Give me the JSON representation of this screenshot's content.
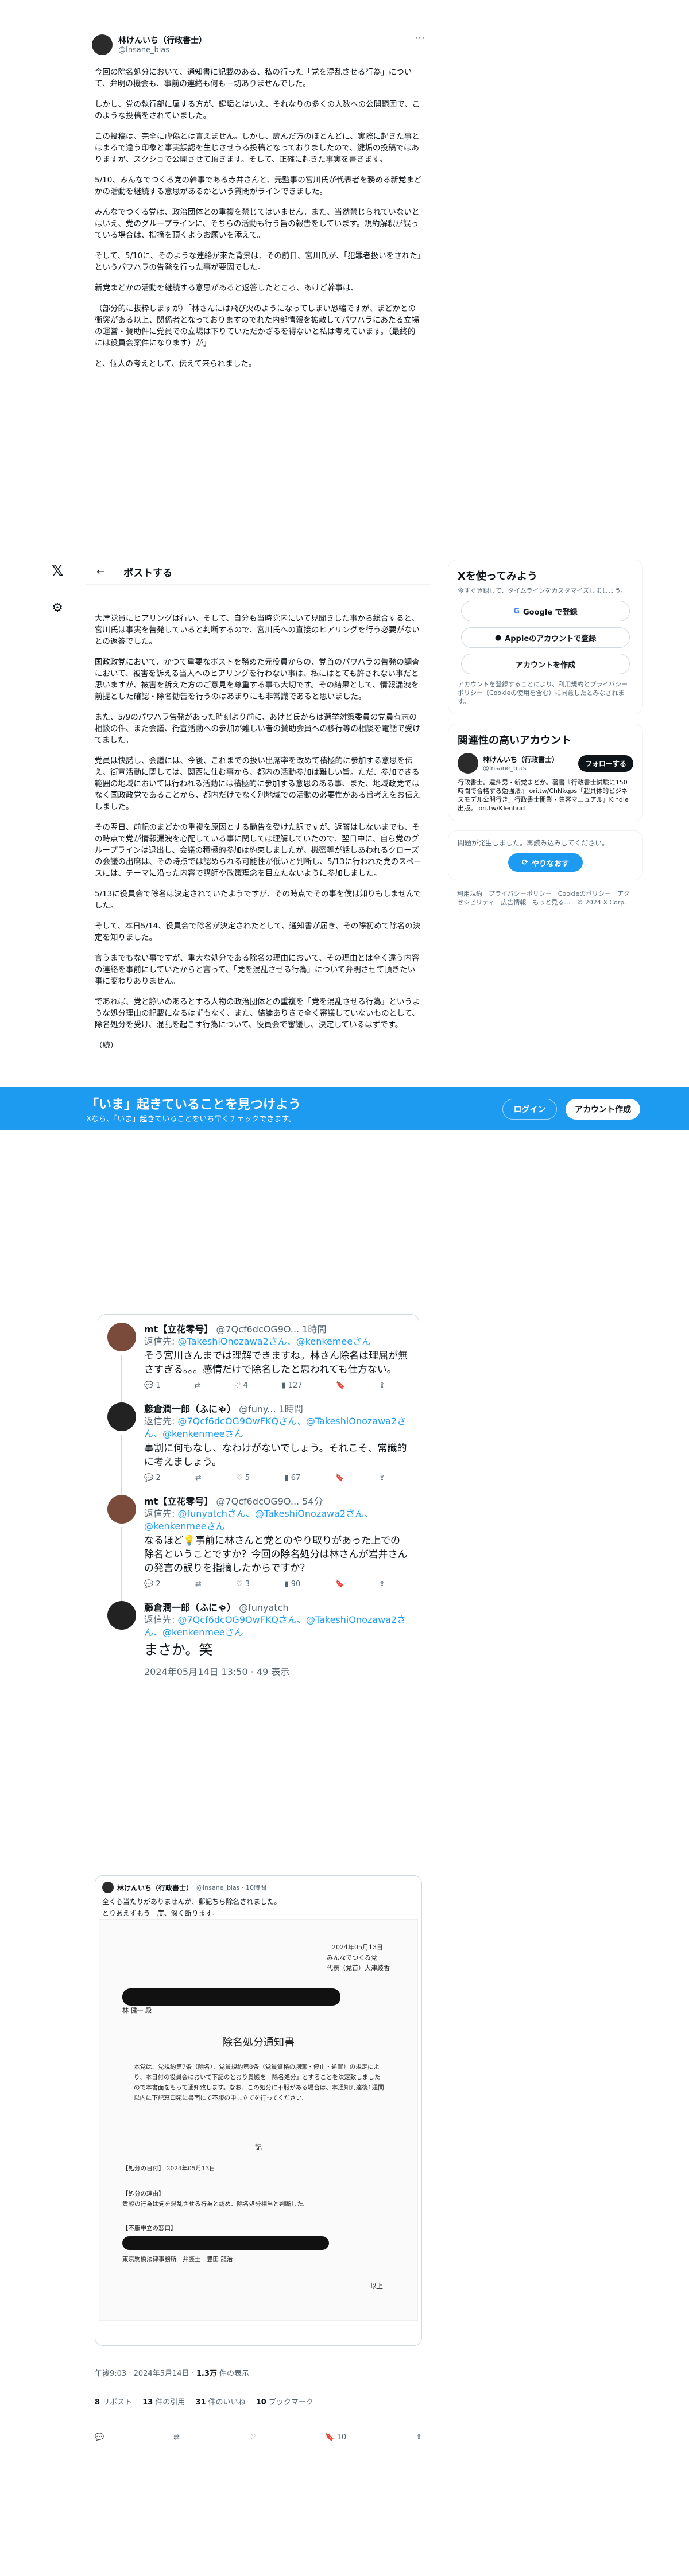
{
  "author": {
    "name": "林けんいち（行政書士）",
    "handle": "@Insane_bias",
    "avatar_icon": "avatar"
  },
  "tweet_paragraphs": [
    "今回の除名処分において、通知書に記載のある、私の行った「党を混乱させる行為」について、弁明の機会も、事前の連絡も何も一切ありませんでした。",
    "しかし、党の執行部に属する方が、鍵垢とはいえ、それなりの多くの人数への公開範囲で、このような投稿をされていました。",
    "この投稿は、完全に虚偽とは言えません。しかし、読んだ方のほとんどに、実際に起きた事とはまるで違う印象と事実誤認を生じさせうる投稿となっておりましたので、鍵垢の投稿ではありますが、スクショで公開させて頂きます。そして、正確に起きた事実を書きます。",
    "5/10、みんなでつくる党の幹事である赤井さんと、元監事の宮川氏が代表者を務める新党まどかの活動を継続する意思があるかという質問がラインできました。",
    "みんなでつくる党は、政治団体との重複を禁じてはいません。また、当然禁じられていないとはいえ、党のグループラインに、そちらの活動も行う旨の報告をしています。規約解釈が誤っている場合は、指摘を頂くようお願いを添えて。",
    "そして、5/10に、そのような連絡が来た背景は、その前日、宮川氏が、「犯罪者扱いをされた」というパワハラの告発を行った事が要因でした。",
    "新党まどかの活動を継続する意思があると返答したところ、あけど幹事は、",
    "（部分的に抜粋しますが）「林さんには飛び火のようになってしまい恐縮ですが、まどかとの衝突がある以上、関係者となっておりますのでれた内部情報を拡散してパワハラにあたる立場の運営・賛助件に党員での立場は下りていただかざるを得ないと私は考えています。（最終的には役員会案件になります）が」",
    "と、個人の考えとして、伝えて来られました。"
  ],
  "tweet_paragraphs_2": [
    "大津党員にヒアリングは行い、そして、自分も当時党内にいて見聞きした事から総合すると、宮川氏は事実を告発していると判断するので、宮川氏への直接のヒアリングを行う必要がないとの返答でした。",
    "国政政党において、かつて重要なポストを務めた元役員からの、党首のパワハラの告発の調査において、被害を訴える当人へのヒアリングを行わない事は、私にはとても許されない事だと思いますが、被害を訴えた方のご意見を尊重する事も大切です。その結果として、情報漏洩を前提とした確認・除名勧告を行うのはあまりにも非常識であると思いました。",
    "また、5/9のパワハラ告発があった時刻より前に、あけど氏からは選挙対策委員の党員有志の相談の件、また会議、街宣活動への参加が難しい者の賛助会員への移行等の相談を電話で受けてました。",
    "党員は快諾し、会議には、今後、これまでの扱い出席率を改めて積極的に参加する意思を伝え、街宣活動に関しては、関西に住む事から、都内の活動参加は難しい旨。ただ、参加できる範囲の地域においては行われる活動には積極的に参加する意思のある事、また、地域政党ではなく国政政党であることから、都内だけでなく別地域での活動の必要性がある旨考えをお伝えしました。",
    "その翌日、前記のまどかの重複を原因とする勧告を受けた訳ですが、返答はしないまでも、その時点で党が情報漏洩を心配している事に関しては理解していたので、翌日中に、自ら党のグループラインは退出し、会議の積極的参加は約束しましたが、機密等が話しあわれるクローズの会議の出席は、その時点では認められる可能性が低いと判断し、5/13に行われた党のスペースには、テーマに沿った内容で講師や政策理念を目立たないように参加しました。",
    "5/13に役員会で除名は決定されていたようですが、その時点でその事を僕は知りもしませんでした。",
    "そして、本日5/14、役員会で除名が決定されたとして、通知書が届き、その際初めて除名の決定を知りました。",
    "言うまでもない事ですが、重大な処分である除名の理由において、その理由とは全く違う内容の連絡を事前にしていたからと言って、「党を混乱させる行為」について弁明させて頂きたい事に変わりありません。",
    "であれば、党と諍いのあるとする人物の政治団体との重複を「党を混乱させる行為」というような処分理由の記載になるはずもなく、また、結論ありきで全く審議していないものとして、除名処分を受け、混乱を起こす行為について、役員会で審議し、決定しているはずです。",
    "（続）"
  ],
  "post_header": {
    "title": "ポストする"
  },
  "sidebar": {
    "login_title": "Xを使ってみよう",
    "login_sub": "今すぐ登録して、タイムラインをカスタマイズしましょう。",
    "google": "Google で登録",
    "apple": "Appleのアカウントで登録",
    "create": "アカウントを作成",
    "terms": "アカウントを登録することにより、利用規約とプライバシーポリシー（Cookieの使用を含む）に同意したとみなされます。",
    "related_title": "関連性の高いアカウント",
    "related_desc": "行政書士。遺州男・新党まどか。著書『行政書士試験に150時間で合格する勉強法』 ori.tw/ChNkgps「超具体的ビジネスモデル公開行き」行政書士開業・集客マニュアル』Kindle出版。 ori.tw/KTenhud",
    "follow": "フォローする",
    "error": "問題が発生しました。再読み込みしてください。",
    "retry": "やりなおす",
    "footer": "利用規約　プライバシーポリシー　Cookieのポリシー　アクセシビリティ　広告情報　もっと見る…　© 2024 X Corp."
  },
  "banner": {
    "title": "「いま」起きていることを見つけよう",
    "sub": "Xなら、「いま」起きていることをいち早くチェックできます。",
    "login": "ログイン",
    "signup": "アカウント作成"
  },
  "quote_thread": [
    {
      "name": "mt【立花零号】",
      "handle": "@7Qcf6dcOG9O...",
      "time": "1時間",
      "reply_prefix": "返信先: ",
      "reply_to": "@TakeshiOnozawa2さん、@kenkemeeさん",
      "text": "そう宮川さんまでは理解できますね。林さん除名は理屈が無さすぎる。。。感情だけで除名したと思われても仕方ない。",
      "replies": "1",
      "rts": "",
      "likes": "4",
      "views": "127"
    },
    {
      "name": "藤倉潤一郎（ふにゃ）",
      "handle": "@funy...",
      "time": "1時間",
      "reply_prefix": "返信先: ",
      "reply_to": "@7Qcf6dcOG9OwFKQさん、@TakeshiOnozawa2さん、@kenkenmeeさん",
      "text": "事割に何もなし、なわけがないでしょう。それこそ、常識的に考えましょう。",
      "replies": "2",
      "rts": "",
      "likes": "5",
      "views": "67"
    },
    {
      "name": "mt【立花零号】",
      "handle": "@7Qcf6dcOG9O...",
      "time": "54分",
      "reply_prefix": "返信先: ",
      "reply_to": "@funyatchさん、@TakeshiOnozawa2さん、@kenkenmeeさん",
      "text": "なるほど💡事前に林さんと党とのやり取りがあった上での除名ということですか？今回の除名処分は林さんが岩井さんの発言の誤りを指摘したからですか？",
      "replies": "2",
      "rts": "",
      "likes": "3",
      "views": "90"
    },
    {
      "name": "藤倉潤一郎（ふにゃ）",
      "handle": "@funyatch",
      "time": "",
      "reply_prefix": "返信先: ",
      "reply_to": "@7Qcf6dcOG9OwFKQさん、@TakeshiOnozawa2さん、@kenkenmeeさん",
      "text": "まさか。笑",
      "date": "2024年05月14日 13:50 · 49 表示"
    }
  ],
  "quote2": {
    "name": "林けんいち（行政書士）",
    "handle": "@Insane_bias · 10時間",
    "text": "全く心当たりがありませんが、郵記ちら除名されました。",
    "text2": "とりあえずもう一度、深く断ります。"
  },
  "document": {
    "date": "2024年05月13日",
    "org": "みんなでつくる党",
    "rep": "代表（党首）大津綾香",
    "to": "林 健一 殿",
    "title": "除名処分通知書",
    "body": "本党は、党規約第7条（除名）、党員規約第8条（党員資格の剥奪・停止・処置）の規定により、本日付の役員会において下記のとおり貴殿を「除名処分」とすることを決定致しましたので本書面をもって通知致します。なお、この処分に不服がある場合は、本通知到達後1週間以内に下記窓口宛に書面にて不服の申し立てを行ってください。",
    "ki": "記",
    "l1": "【処分の日付】 2024年05月13日",
    "l2": "【処分の理由】",
    "l3": "貴殿の行為は党を混乱させる行為と認め、除名処分相当と判断した。",
    "l4": "【不服申立の窓口】",
    "l5": "東京駒橋法律事務所　弁護士　豊田 龍治",
    "ijo": "以上"
  },
  "meta": {
    "time": "午後9:03 · 2024年5月14日 · ",
    "views": "1.3万",
    "views_label": " 件の表示"
  },
  "stats": [
    {
      "n": "8",
      "l": " リポスト"
    },
    {
      "n": "13",
      "l": " 件の引用"
    },
    {
      "n": "31",
      "l": " 件のいいね"
    },
    {
      "n": "10",
      "l": " ブックマーク"
    }
  ],
  "actions": {
    "bookmark_count": "10"
  },
  "colors": {
    "accent": "#1d9bf0",
    "text": "#0f1419",
    "muted": "#536471"
  }
}
